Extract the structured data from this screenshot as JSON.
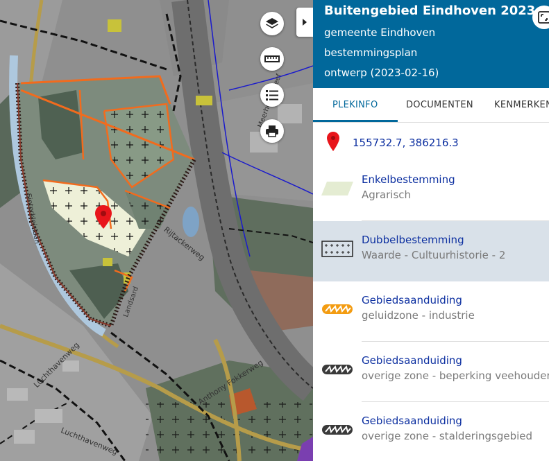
{
  "map": {
    "street_labels": [
      "Rijtackerweg",
      "Luchthavenweg",
      "Luchthavenweg",
      "Anthony Fokkerweg",
      "Landsard",
      "Sinterkleislaan",
      "Meerhovendreef"
    ],
    "layers_icon": "layers-icon",
    "measure_icon": "ruler-icon",
    "legend_icon": "list-icon",
    "print_icon": "printer-icon",
    "collapse_icon": "chevron-right-icon"
  },
  "panel": {
    "title": "Buitengebied Eindhoven 2023",
    "municipality": "gemeente Eindhoven",
    "plan_type": "bestemmingsplan",
    "status": "ontwerp (2023-02-16)",
    "tabs": [
      {
        "label": "PLEKINFO",
        "active": true
      },
      {
        "label": "DOCUMENTEN",
        "active": false
      },
      {
        "label": "KENMERKEN",
        "active": false
      }
    ],
    "coordinates": "155732.7, 386216.3",
    "items": [
      {
        "title": "Enkelbestemming",
        "value": "Agrarisch",
        "icon": "agrarisch-swatch-icon",
        "selected": false
      },
      {
        "title": "Dubbelbestemming",
        "value": "Waarde - Cultuurhistorie - 2",
        "icon": "cross-hatch-swatch-icon",
        "selected": true
      },
      {
        "title": "Gebiedsaanduiding",
        "value": "geluidzone - industrie",
        "icon": "orange-zone-swatch-icon",
        "selected": false
      },
      {
        "title": "Gebiedsaanduiding",
        "value": "overige zone - beperking veehouderij",
        "icon": "grey-zone-swatch-icon",
        "selected": false
      },
      {
        "title": "Gebiedsaanduiding",
        "value": "overige zone - stalderingsgebied",
        "icon": "grey-zone-swatch-icon",
        "selected": false
      }
    ],
    "colors": {
      "header": "#01689b",
      "link": "#0c2fa0",
      "selected_row": "#d9e1e9",
      "marker": "#e8151b",
      "orange_zone": "#f39c12",
      "agrarisch": "#e4ecd2"
    }
  }
}
